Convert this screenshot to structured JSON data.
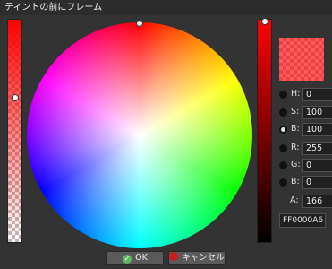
{
  "window": {
    "title": "ティントの前にフレーム"
  },
  "picker": {
    "hsv": [
      {
        "label": "H:",
        "value": "0",
        "checked": false
      },
      {
        "label": "S:",
        "value": "100",
        "checked": false
      },
      {
        "label": "B:",
        "value": "100",
        "checked": true
      }
    ],
    "rgb": [
      {
        "label": "R:",
        "value": "255",
        "checked": false
      },
      {
        "label": "G:",
        "value": "0",
        "checked": false
      },
      {
        "label": "B:",
        "value": "0",
        "checked": false
      }
    ],
    "alpha": {
      "label": "A:",
      "value": "166"
    },
    "hex": "FF0000A6",
    "color": "#ff0000",
    "alpha_fraction": 0.65
  },
  "buttons": {
    "ok": "OK",
    "cancel": "キャンセル"
  },
  "icons": {
    "ok": "check-icon",
    "cancel": "cancel-icon"
  }
}
